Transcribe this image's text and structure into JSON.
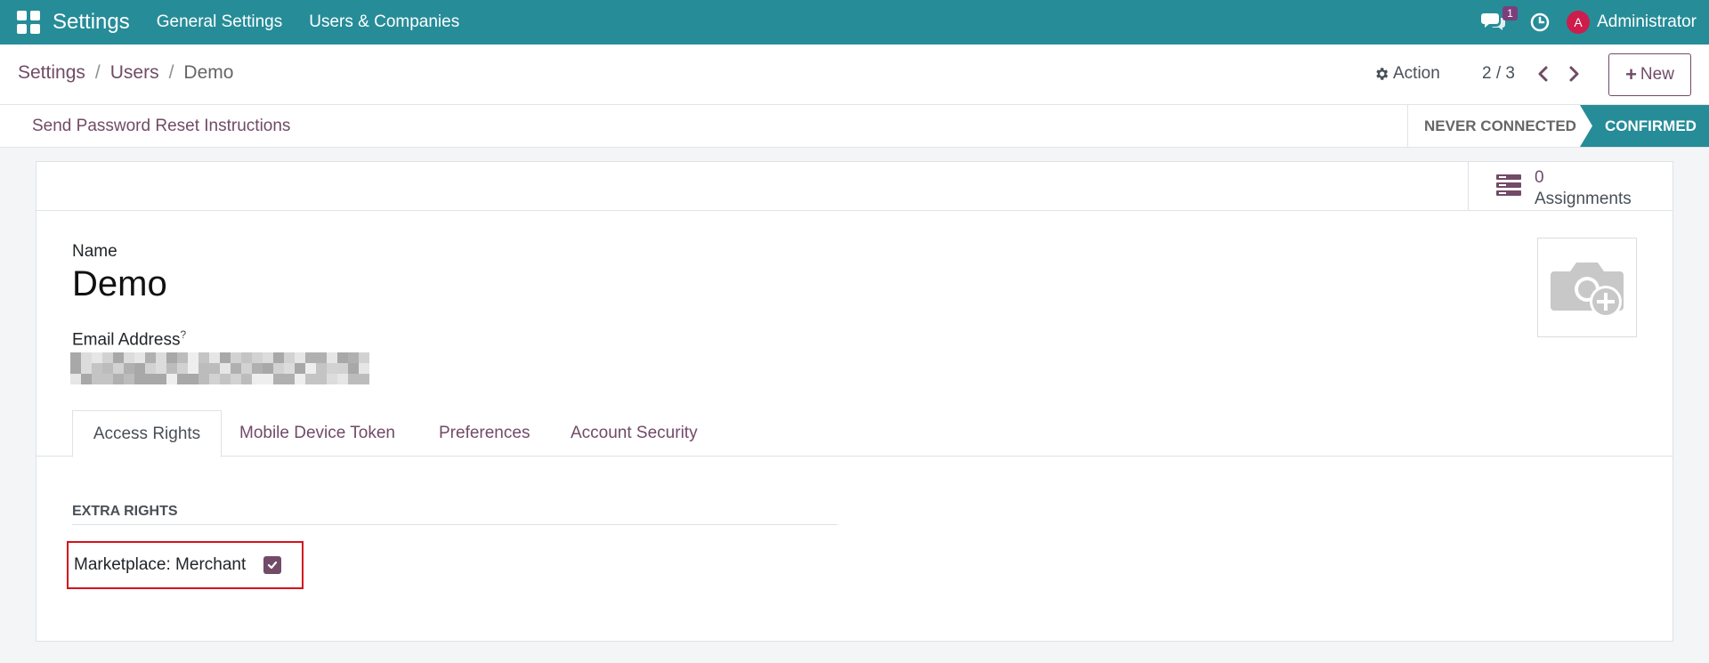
{
  "navbar": {
    "brand": "Settings",
    "menus": [
      "General Settings",
      "Users & Companies"
    ],
    "chat_badge": "1",
    "avatar_initial": "A",
    "user": "Administrator",
    "color": "#268c98"
  },
  "control_panel": {
    "breadcrumb": [
      "Settings",
      "Users",
      "Demo"
    ],
    "breadcrumb_separator": "/",
    "action_label": "Action",
    "pager": "2 / 3",
    "new_label": "New"
  },
  "statusbar": {
    "button": "Send Password Reset Instructions",
    "stages": [
      "NEVER CONNECTED",
      "CONFIRMED"
    ],
    "active_stage": "CONFIRMED"
  },
  "form": {
    "smart_button": {
      "count": "0",
      "label": "Assignments"
    },
    "name_label": "Name",
    "name_value": "Demo",
    "email_label": "Email Address",
    "email_help": "?",
    "tabs": [
      "Access Rights",
      "Mobile Device Token",
      "Preferences",
      "Account Security"
    ],
    "active_tab": "Access Rights",
    "section_title": "EXTRA RIGHTS",
    "rights": [
      {
        "label": "Marketplace: Merchant",
        "checked": true
      }
    ]
  },
  "icons": [
    "apps-grid-icon",
    "chat-icon",
    "clock-icon",
    "gear-icon",
    "chevron-left-icon",
    "chevron-right-icon",
    "plus-icon",
    "server-icon",
    "camera-plus-icon",
    "check-icon"
  ],
  "accent": "#714b67"
}
